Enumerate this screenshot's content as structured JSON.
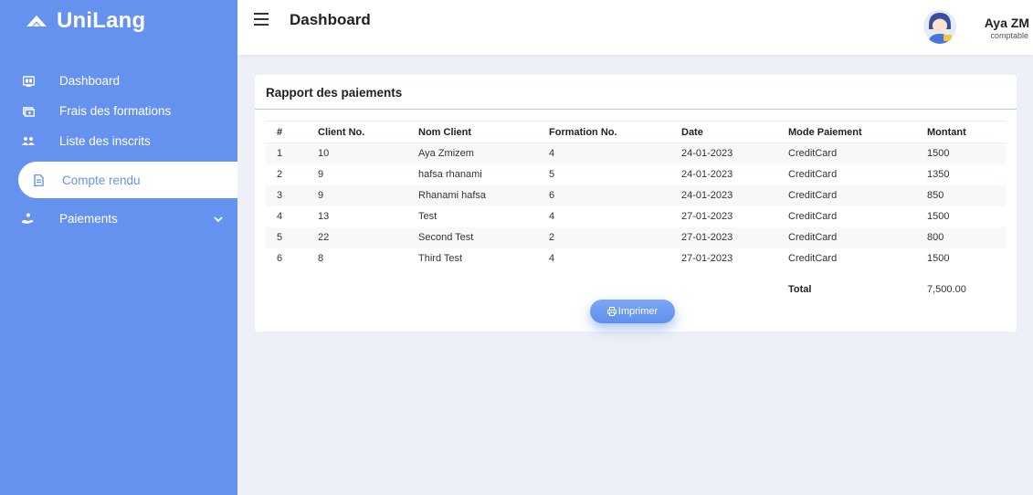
{
  "sidebar": {
    "brand": "UniLang",
    "items": [
      {
        "label": "Dashboard",
        "icon": "dashboard-icon"
      },
      {
        "label": "Frais des formations",
        "icon": "money-icon"
      },
      {
        "label": "Liste des inscrits",
        "icon": "users-icon"
      },
      {
        "label": "Compte rendu",
        "icon": "document-icon"
      },
      {
        "label": "Paiements",
        "icon": "payment-icon"
      }
    ]
  },
  "header": {
    "title": "Dashboard",
    "user_name": "Aya ZM",
    "user_role": "comptable"
  },
  "report": {
    "title": "Rapport des paiements",
    "columns": [
      "#",
      "Client No.",
      "Nom Client",
      "Formation No.",
      "Date",
      "Mode Paiement",
      "Montant"
    ],
    "rows": [
      [
        "1",
        "10",
        "Aya Zmizem",
        "4",
        "24-01-2023",
        "CreditCard",
        "1500"
      ],
      [
        "2",
        "9",
        "hafsa rhanami",
        "5",
        "24-01-2023",
        "CreditCard",
        "1350"
      ],
      [
        "3",
        "9",
        "Rhanami hafsa",
        "6",
        "24-01-2023",
        "CreditCard",
        "850"
      ],
      [
        "4",
        "13",
        "Test",
        "4",
        "27-01-2023",
        "CreditCard",
        "1500"
      ],
      [
        "5",
        "22",
        "Second Test",
        "2",
        "27-01-2023",
        "CreditCard",
        "800"
      ],
      [
        "6",
        "8",
        "Third Test",
        "4",
        "27-01-2023",
        "CreditCard",
        "1500"
      ]
    ],
    "total_label": "Total",
    "total_value": "7,500.00",
    "print_label": "Imprimer"
  },
  "colors": {
    "sidebar": "#6592ee",
    "background": "#eef0f7",
    "accent": "#6592ee"
  }
}
